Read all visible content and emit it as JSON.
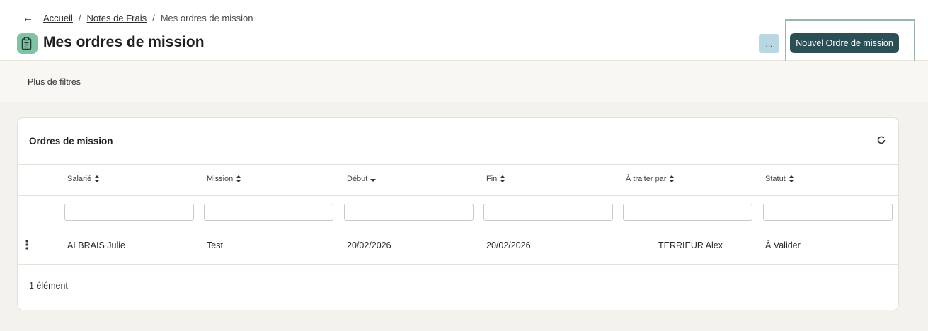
{
  "breadcrumb": {
    "items": [
      "Accueil",
      "Notes de Frais"
    ],
    "separator": "/",
    "current": "Mes ordres de mission"
  },
  "page": {
    "title": "Mes ordres de mission",
    "icon": "clipboard-document-icon",
    "accent_color": "#7ec3a3"
  },
  "actions": {
    "more_label": "...",
    "new_label": "Nouvel Ordre de mission",
    "new_color": "#2c4f56"
  },
  "filters": {
    "more_label": "Plus de filtres"
  },
  "card": {
    "title": "Ordres de mission",
    "columns": [
      "Salarié",
      "Mission",
      "Début",
      "Fin",
      "À traiter par",
      "Statut"
    ],
    "rows": [
      [
        "ALBRAIS Julie",
        "Test",
        "20/02/2026",
        "20/02/2026",
        "TERRIEUR Alex",
        "À Valider"
      ]
    ],
    "count_label": "1 élément"
  }
}
